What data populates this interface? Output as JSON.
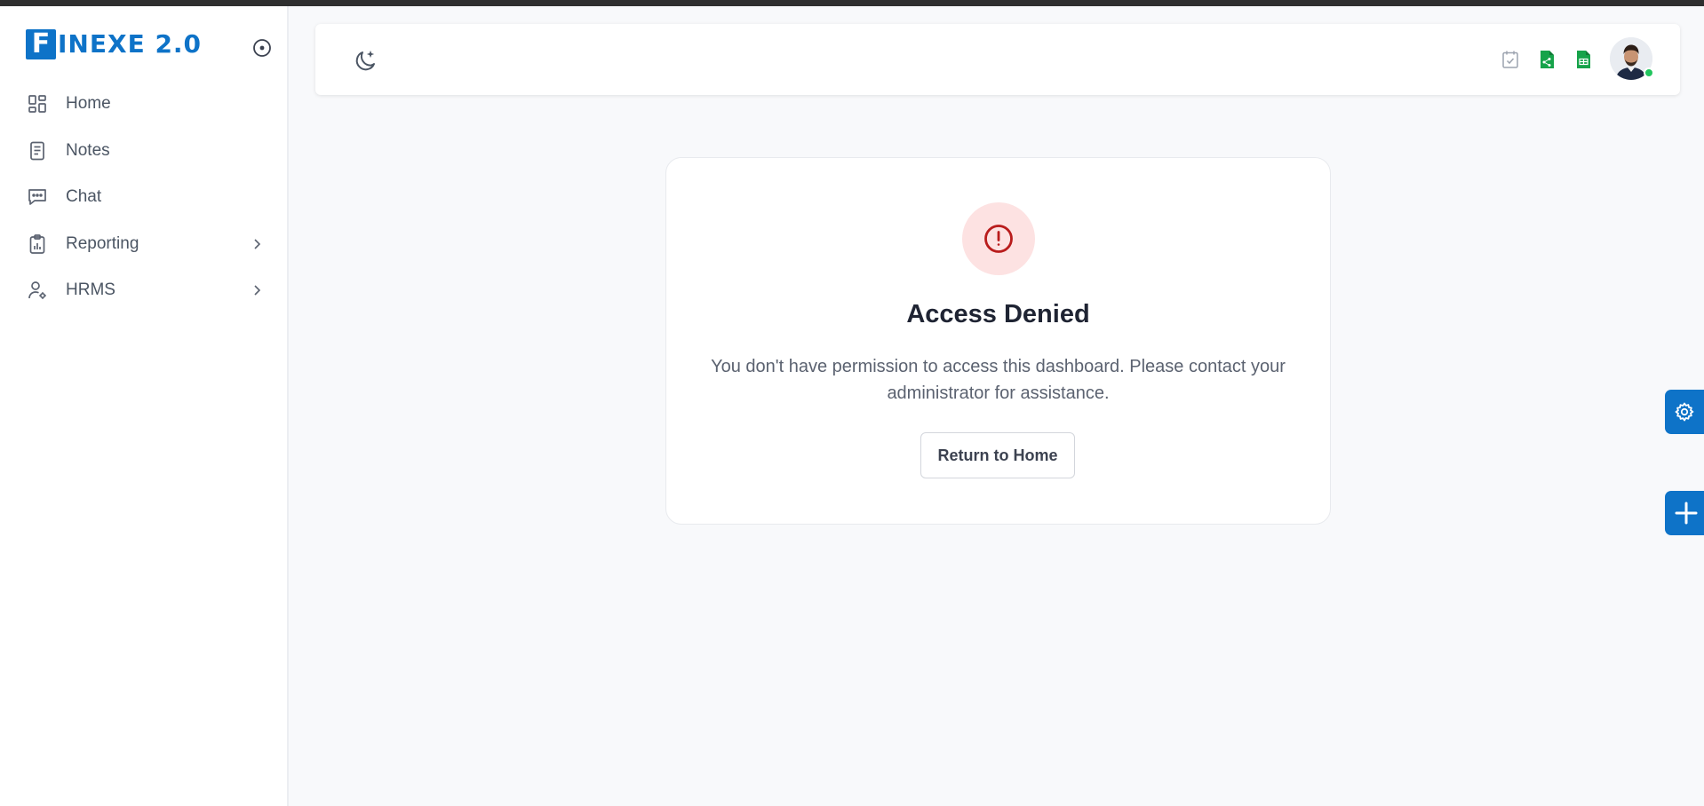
{
  "brand": {
    "letter": "F",
    "name": "INEXE 2.0",
    "color": "#0e73c8"
  },
  "sidebar": {
    "collapse_icon": "circle-dot-icon",
    "items": [
      {
        "label": "Home",
        "icon": "dashboard-grid-icon",
        "has_submenu": false
      },
      {
        "label": "Notes",
        "icon": "document-icon",
        "has_submenu": false
      },
      {
        "label": "Chat",
        "icon": "chat-bubble-icon",
        "has_submenu": false
      },
      {
        "label": "Reporting",
        "icon": "clipboard-chart-icon",
        "has_submenu": true
      },
      {
        "label": "HRMS",
        "icon": "user-gear-icon",
        "has_submenu": true
      }
    ]
  },
  "header": {
    "theme_icon": "moon-stars-icon",
    "actions": [
      {
        "icon": "calendar-check-icon",
        "color": "#9ca3af"
      },
      {
        "icon": "share-sheet-icon",
        "color": "#16a34a"
      },
      {
        "icon": "spreadsheet-icon",
        "color": "#16a34a"
      }
    ],
    "avatar": {
      "status": "online",
      "status_color": "#22c55e"
    }
  },
  "access_denied": {
    "icon": "alert-circle-icon",
    "icon_color": "#b91c1c",
    "icon_bg": "#fde2e2",
    "title": "Access Denied",
    "message": "You don't have permission to access this dashboard. Please contact your administrator for assistance.",
    "button_label": "Return to Home"
  },
  "floating": [
    {
      "icon": "gear-icon",
      "color": "#0e73c8"
    },
    {
      "icon": "plus-icon",
      "color": "#0e73c8"
    }
  ]
}
